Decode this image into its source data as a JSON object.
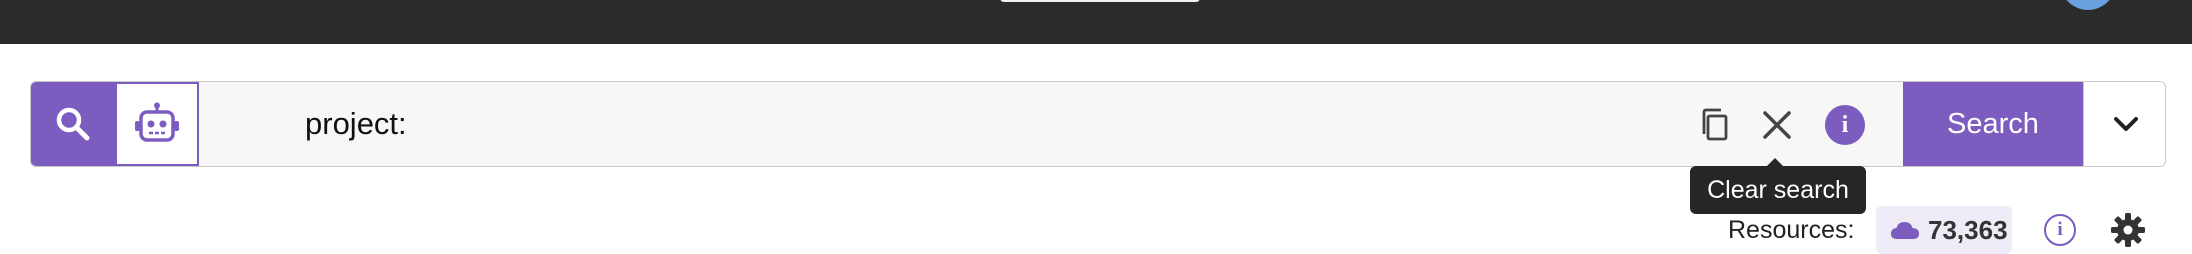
{
  "search": {
    "query_value": "project:",
    "placeholder": "",
    "search_button_label": "Search",
    "clear_tooltip": "Clear search"
  },
  "resources": {
    "label": "Resources:",
    "count": "73,363"
  },
  "icons": {
    "search_mode": "search-icon",
    "ai_mode": "robot-icon",
    "copy": "copy-icon",
    "clear": "close-icon",
    "info": "info-icon",
    "dropdown": "chevron-down-icon",
    "cloud": "cloud-icon",
    "resources_info": "info-outline-icon",
    "settings": "gear-icon"
  },
  "colors": {
    "accent": "#7c5cbf",
    "topbar": "#2b2b2b",
    "tooltip_bg": "#262626",
    "badge_bg": "#eeeaf6"
  }
}
